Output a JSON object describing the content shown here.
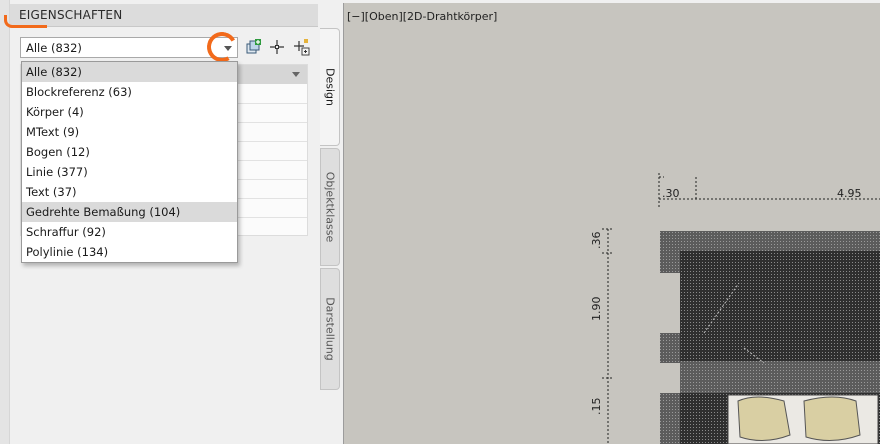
{
  "palette": {
    "title": "EIGENSCHAFTEN",
    "select": {
      "value": "Alle (832)"
    },
    "toolbar": [
      {
        "name": "quick-select-icon"
      },
      {
        "name": "select-objects-icon"
      },
      {
        "name": "toggle-pickadd-icon"
      }
    ],
    "dropdown_items": [
      {
        "label": "Alle (832)",
        "selected": true
      },
      {
        "label": "Blockreferenz (63)",
        "selected": false
      },
      {
        "label": "Körper (4)",
        "selected": false
      },
      {
        "label": "MText (9)",
        "selected": false
      },
      {
        "label": "Bogen (12)",
        "selected": false
      },
      {
        "label": "Linie (377)",
        "selected": false
      },
      {
        "label": "Text (37)",
        "selected": false
      },
      {
        "label": "Gedrehte Bemaßung (104)",
        "selected": false,
        "hovered": true
      },
      {
        "label": "Schraffur (92)",
        "selected": false
      },
      {
        "label": "Polylinie (134)",
        "selected": false
      }
    ],
    "tabs": [
      {
        "label": "Design",
        "active": true
      },
      {
        "label": "Objektklasse",
        "active": false
      },
      {
        "label": "Darstellung",
        "active": false
      }
    ]
  },
  "viewport": {
    "label": "[−][Oben][2D-Drahtkörper]",
    "dimensions": {
      "top_left": ".30",
      "top_right": "4.95",
      "left_top": ".36",
      "left_middle": "1.90",
      "left_bottom": ".15"
    }
  },
  "colors": {
    "annotation": "#f26a1b",
    "viewport_bg": "#c7c5bf",
    "hatch_fill": "#d9cfa3"
  }
}
